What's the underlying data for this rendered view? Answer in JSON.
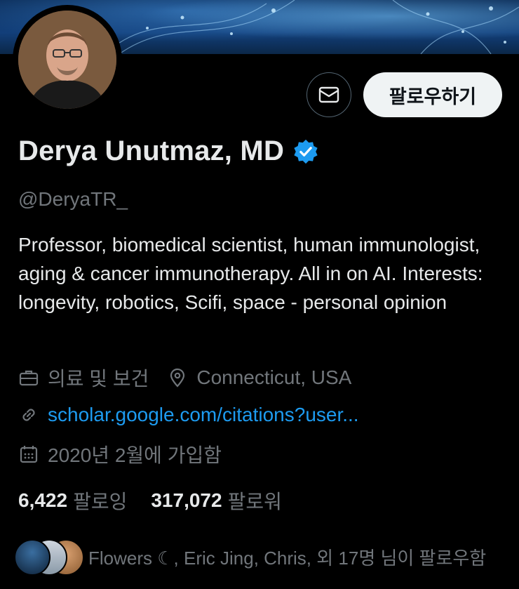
{
  "profile": {
    "name": "Derya Unutmaz, MD",
    "handle": "@DeryaTR_",
    "bio": "Professor, biomedical scientist, human immunologist, aging & cancer immunotherapy. All in on AI. Interests: longevity, robotics, Scifi, space - personal opinion",
    "category": "의료 및 보건",
    "location": "Connecticut, USA",
    "link": "scholar.google.com/citations?user...",
    "joined": "2020년 2월에 가입함"
  },
  "actions": {
    "follow_label": "팔로우하기",
    "message_icon": "envelope-icon"
  },
  "counts": {
    "following_value": "6,422",
    "following_label": "팔로잉",
    "followers_value": "317,072",
    "followers_label": "팔로워"
  },
  "followed_by": {
    "text": "Flowers ☾, Eric Jing, Chris, 외 17명 님이 팔로우함"
  },
  "colors": {
    "background": "#000000",
    "text_primary": "#e7e9ea",
    "text_secondary": "#71767b",
    "link": "#1d9bf0",
    "verified": "#1d9bf0",
    "follow_button_bg": "#eff3f4"
  },
  "icons": {
    "category": "briefcase-icon",
    "location": "location-pin-icon",
    "link": "link-icon",
    "joined": "calendar-icon",
    "verified": "verified-badge-icon"
  }
}
